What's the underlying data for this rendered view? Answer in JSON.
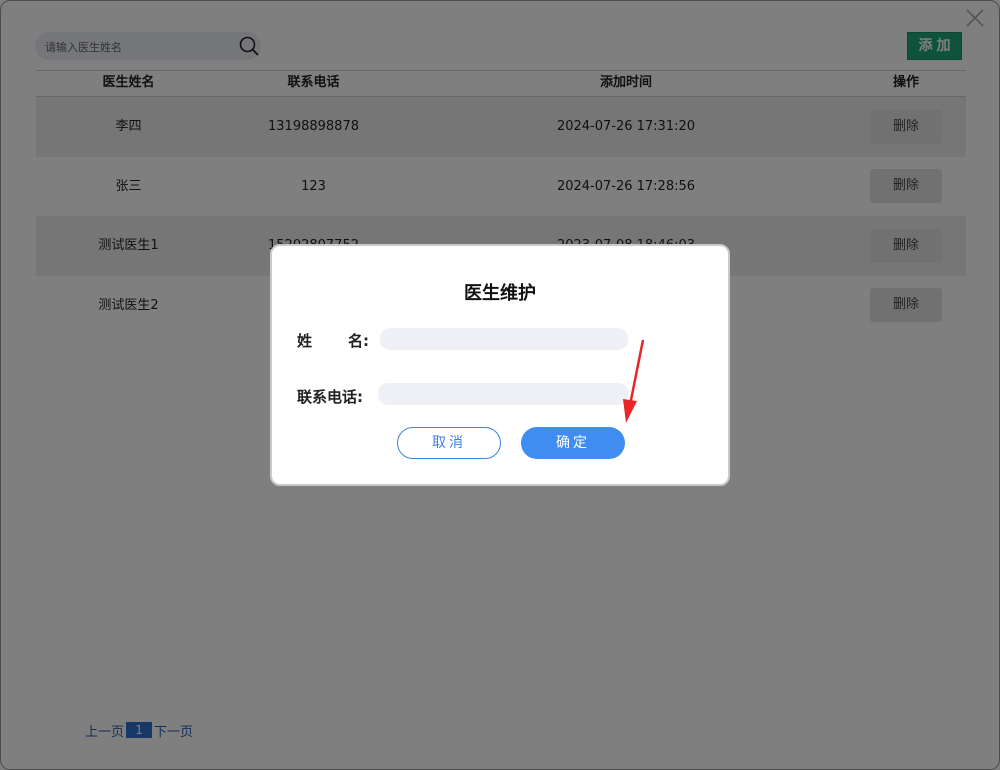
{
  "search": {
    "placeholder": "请输入医生姓名"
  },
  "toolbar": {
    "add_label": "添加"
  },
  "table": {
    "headers": [
      "医生姓名",
      "联系电话",
      "添加时间",
      "操作"
    ],
    "rows": [
      {
        "name": "李四",
        "phone": "13198898878",
        "time": "2024-07-26 17:31:20",
        "action": "删除"
      },
      {
        "name": "张三",
        "phone": "123",
        "time": "2024-07-26 17:28:56",
        "action": "删除"
      },
      {
        "name": "测试医生1",
        "phone": "15202807752",
        "time": "2023-07-08 18:46:03",
        "action": "删除"
      },
      {
        "name": "测试医生2",
        "phone": "",
        "time": "",
        "action": "删除"
      }
    ]
  },
  "pagination": {
    "prev": "上一页",
    "current": "1",
    "next": "下一页"
  },
  "dialog": {
    "title": "医生维护",
    "name_label_first": "姓",
    "name_label_second": "名:",
    "phone_label": "联系电话:",
    "name_value": "",
    "phone_value": "",
    "cancel_label": "取消",
    "confirm_label": "确定"
  },
  "colors": {
    "accent_green": "#1fa67a",
    "primary_blue": "#3f8df0",
    "annotation_red": "#e8262a"
  }
}
